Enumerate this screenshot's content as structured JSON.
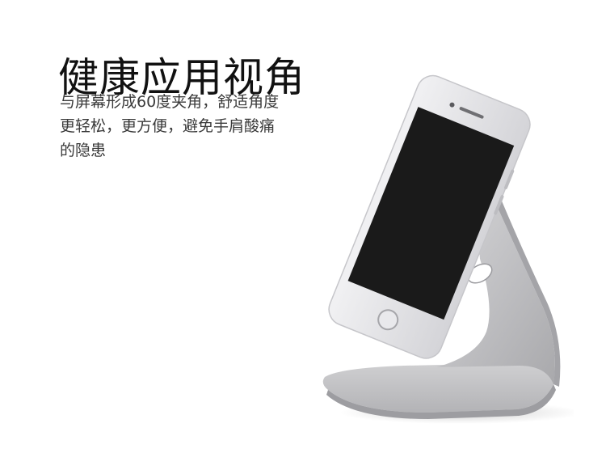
{
  "headline": "健康应用视角",
  "description": {
    "lines": [
      "与屏幕形成60度夹角，舒适角度",
      "更轻松，更方便，避免手肩酸痛",
      "的隐患"
    ]
  },
  "product_image": {
    "colors": {
      "stand": "#c9c9cb",
      "stand_shadow": "#9a9a9d",
      "phone_body": "#e3e3e6",
      "screen": "#1a1a1a"
    }
  }
}
